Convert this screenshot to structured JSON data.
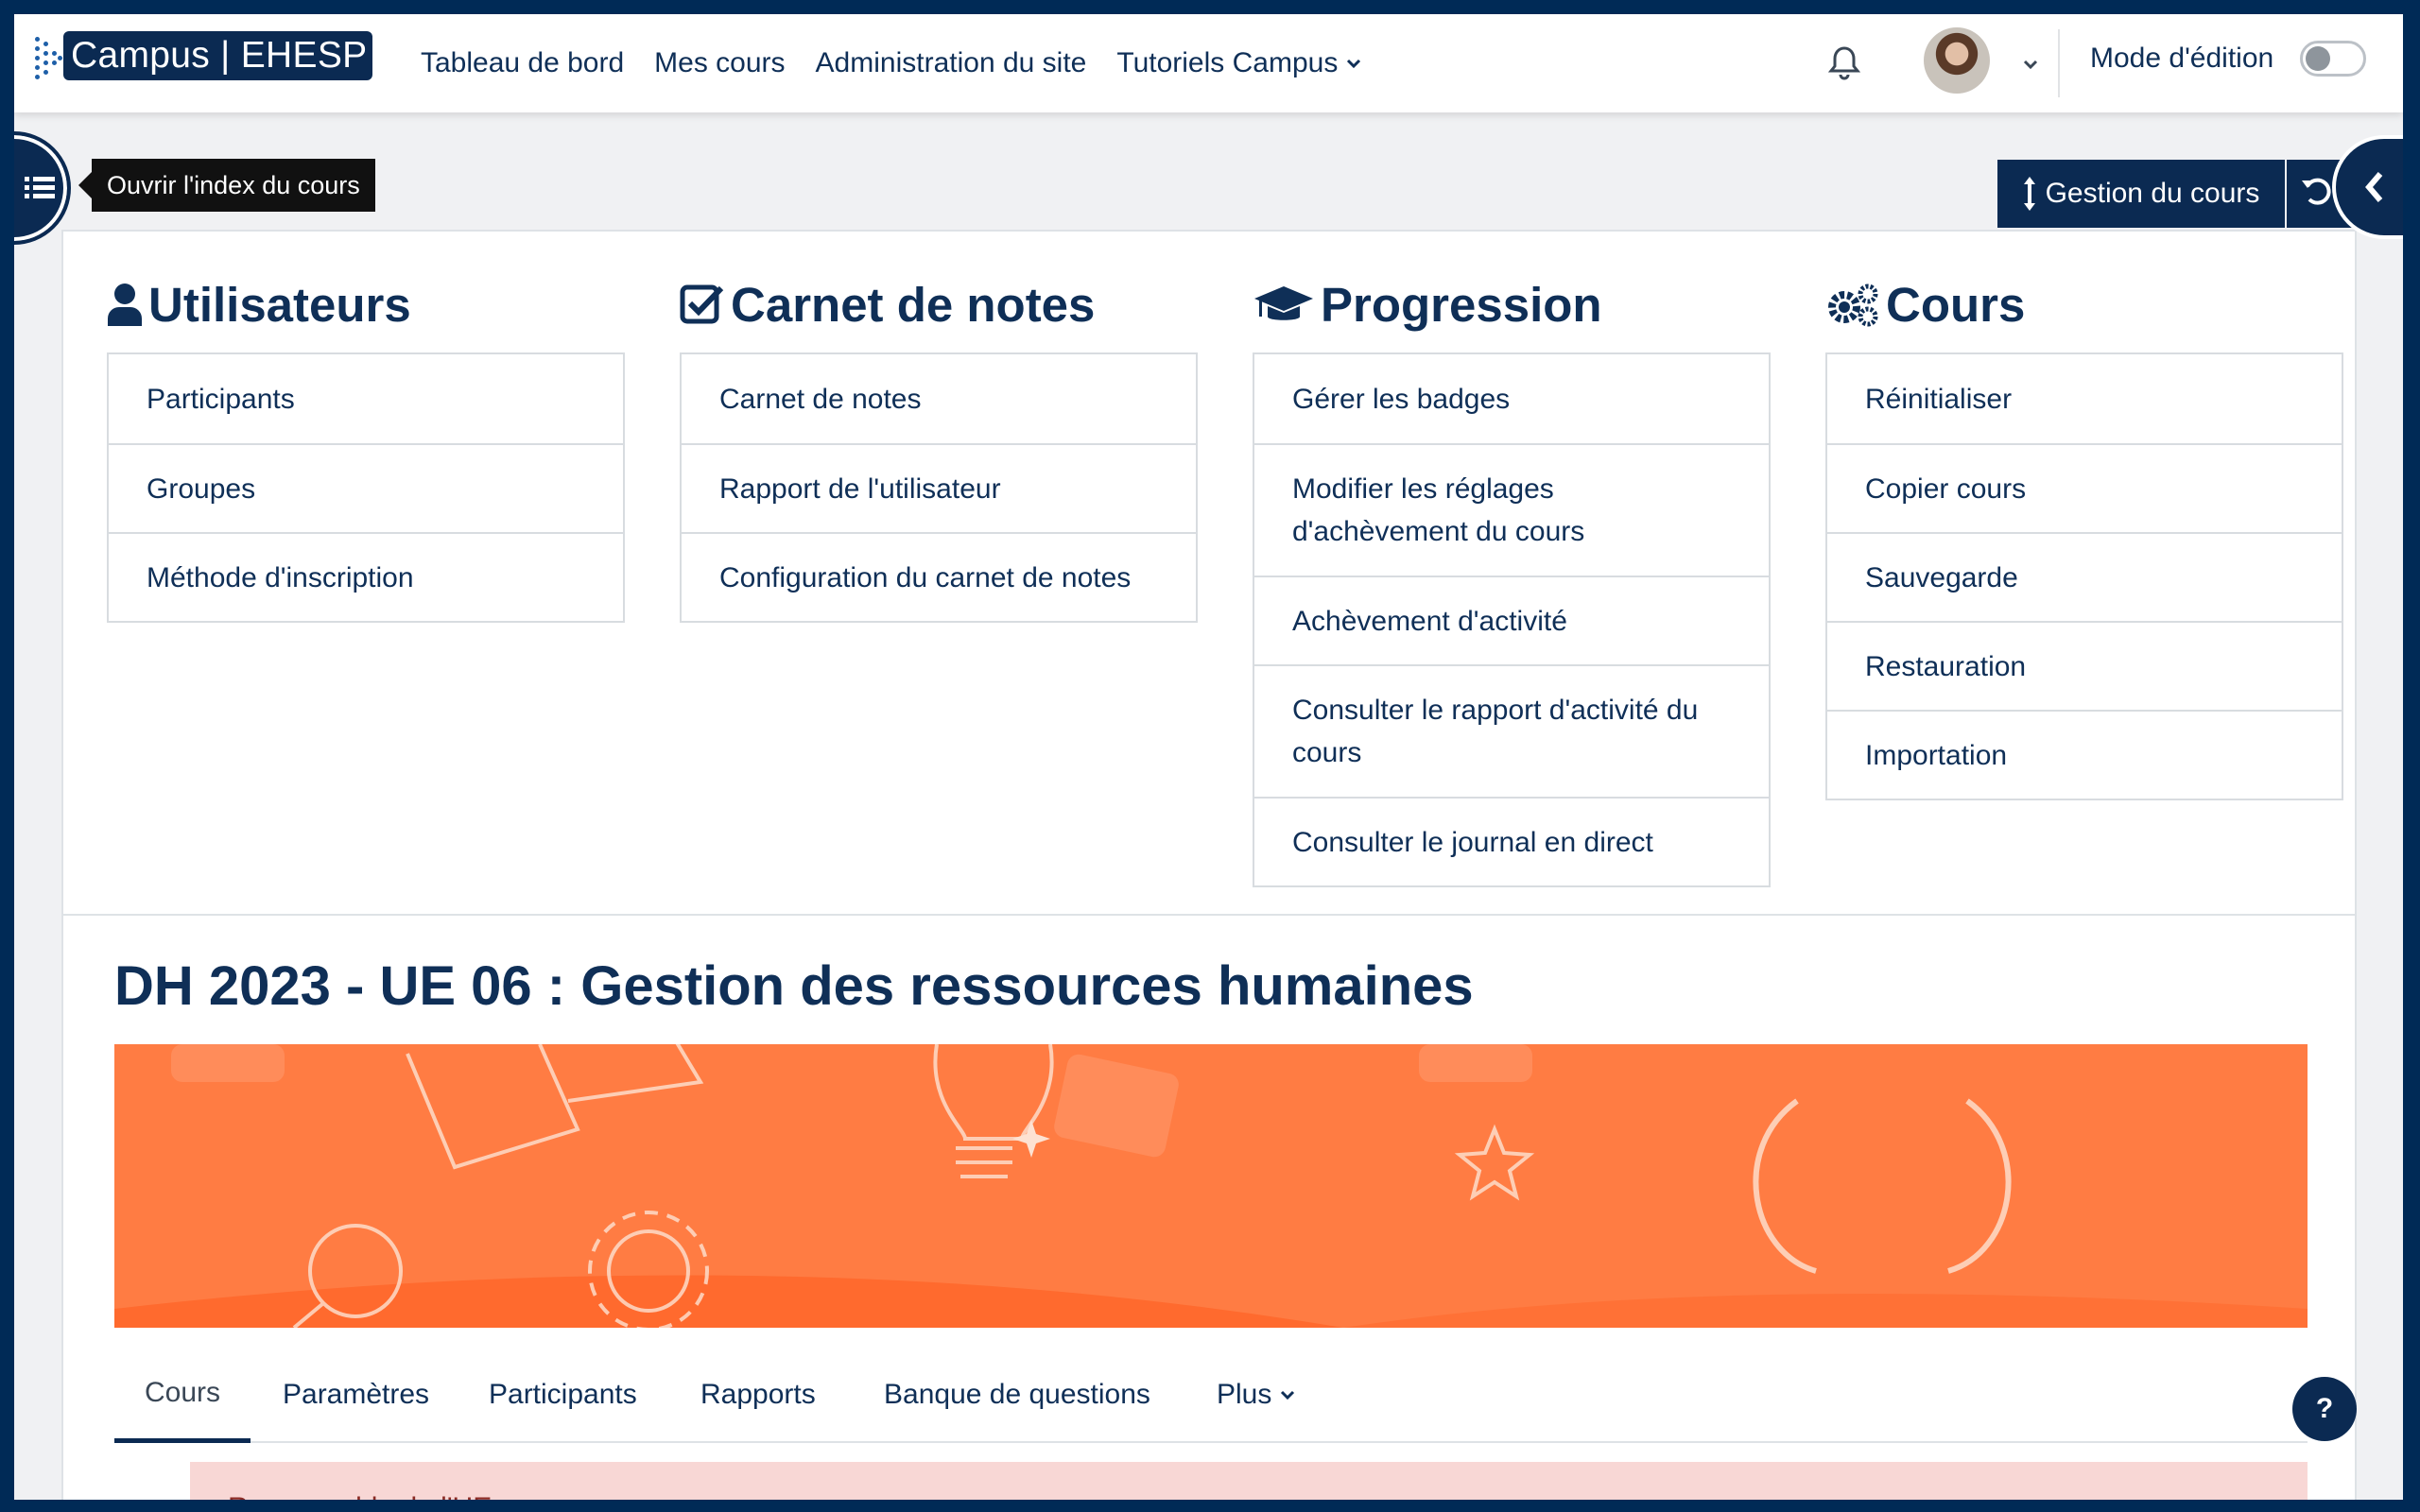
{
  "brand": {
    "logo_text": "Campus | EHESP"
  },
  "navbar": {
    "links": [
      "Tableau de bord",
      "Mes cours",
      "Administration du site",
      "Tutoriels Campus"
    ],
    "edit_mode_label": "Mode d'édition"
  },
  "course_index": {
    "tooltip": "Ouvrir l'index du cours"
  },
  "toolbar": {
    "gestion_label": "Gestion du cours"
  },
  "menu": {
    "columns": [
      {
        "title": "Utilisateurs",
        "icon": "user-icon",
        "items": [
          "Participants",
          "Groupes",
          "Méthode d'inscription"
        ]
      },
      {
        "title": "Carnet de notes",
        "icon": "check-square-icon",
        "items": [
          "Carnet de notes",
          "Rapport de l'utilisateur",
          "Configuration du carnet de notes"
        ]
      },
      {
        "title": "Progression",
        "icon": "graduation-cap-icon",
        "items": [
          "Gérer les badges",
          "Modifier les réglages d'achèvement du cours",
          "Achèvement d'activité",
          "Consulter le rapport d'activité du cours",
          "Consulter le journal en direct"
        ]
      },
      {
        "title": "Cours",
        "icon": "cogs-icon",
        "items": [
          "Réinitialiser",
          "Copier cours",
          "Sauvegarde",
          "Restauration",
          "Importation"
        ]
      }
    ]
  },
  "course": {
    "title": "DH 2023 - UE 06 : Gestion des ressources humaines",
    "banner_color": "#ff7c43"
  },
  "tabs": {
    "items": [
      "Cours",
      "Paramètres",
      "Participants",
      "Rapports",
      "Banque de questions",
      "Plus"
    ],
    "active": "Cours"
  },
  "alert": {
    "text": "Responsable de l'UE"
  },
  "help": {
    "label": "?"
  },
  "colors": {
    "primary": "#0b2a52",
    "text": "#0f2f57",
    "alert_bg": "#f8d7d5"
  }
}
